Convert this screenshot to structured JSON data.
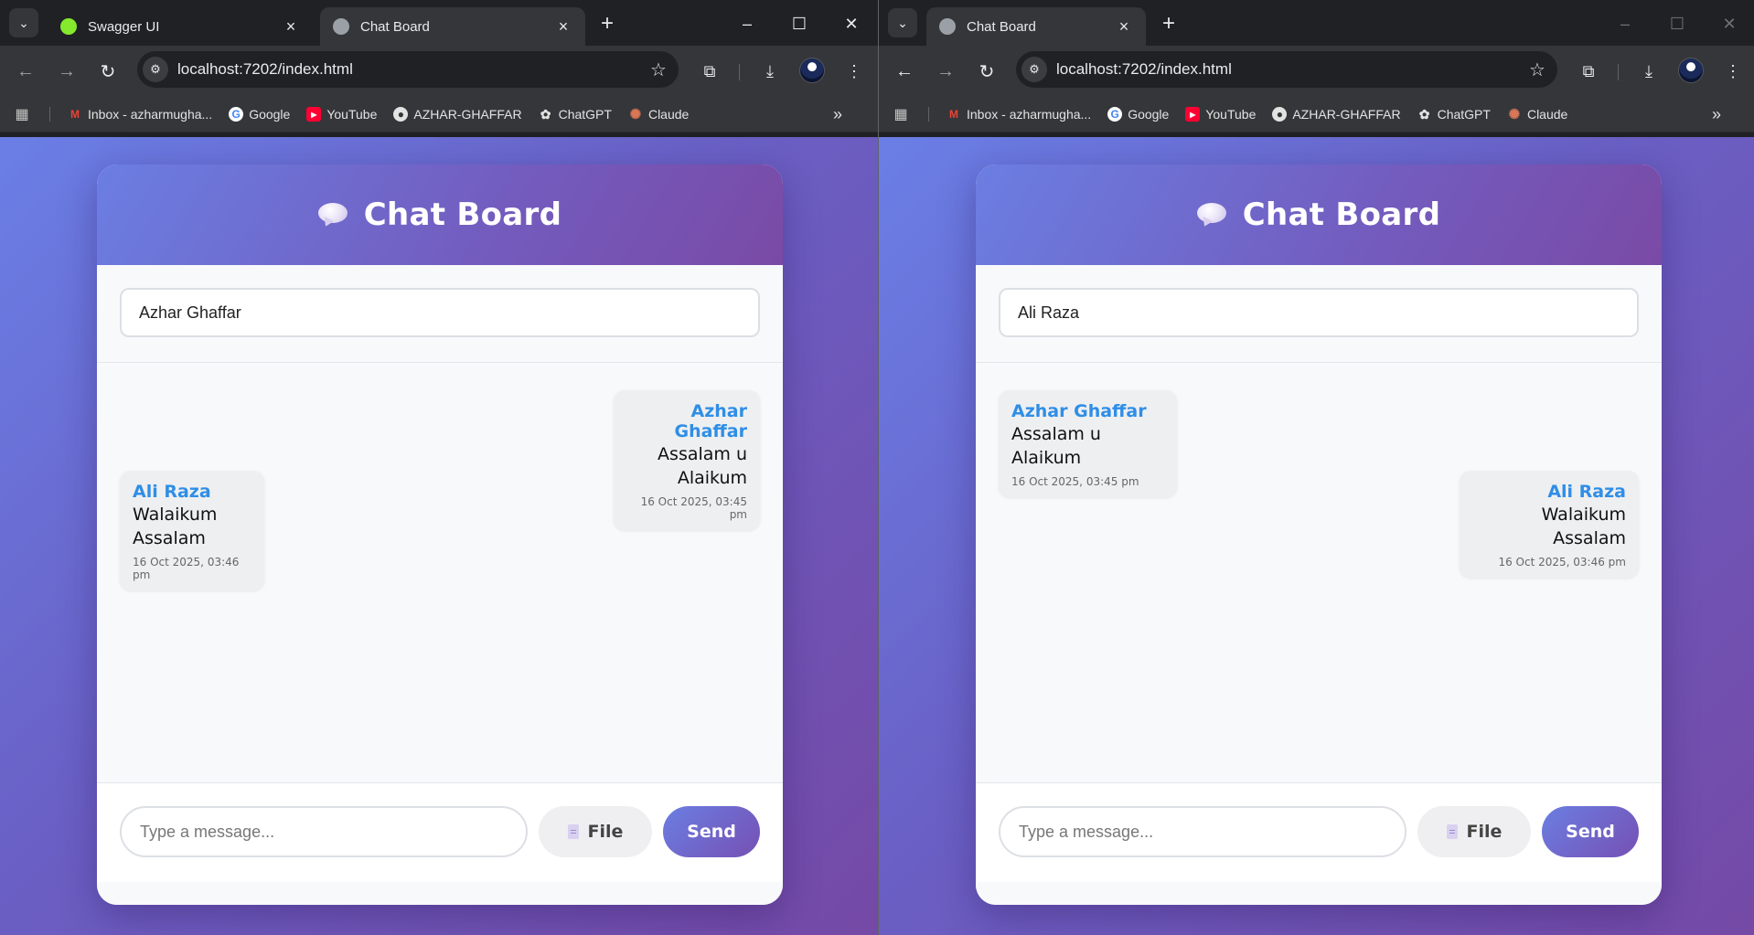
{
  "left": {
    "tabs": [
      {
        "title": "Swagger UI",
        "favicon_color": "#85ea2d",
        "active": false
      },
      {
        "title": "Chat Board",
        "favicon_color": "#9aa0a6",
        "active": true
      }
    ],
    "url": "localhost:7202/index.html",
    "bookmarks": [
      {
        "label": "Inbox - azharmugha...",
        "icon": "gmail-icon"
      },
      {
        "label": "Google",
        "icon": "google-icon"
      },
      {
        "label": "YouTube",
        "icon": "youtube-icon"
      },
      {
        "label": "AZHAR-GHAFFAR",
        "icon": "github-icon"
      },
      {
        "label": "ChatGPT",
        "icon": "chatgpt-icon"
      },
      {
        "label": "Claude",
        "icon": "claude-icon"
      }
    ],
    "app": {
      "title": "Chat Board",
      "name_value": "Azhar Ghaffar",
      "messages": [
        {
          "sender": "Azhar Ghaffar",
          "text": "Assalam u Alaikum",
          "time": "16 Oct 2025, 03:45 pm",
          "align": "right"
        },
        {
          "sender": "Ali Raza",
          "text": "Walaikum Assalam",
          "time": "16 Oct 2025, 03:46 pm",
          "align": "left"
        }
      ],
      "message_placeholder": "Type a message...",
      "file_label": "File",
      "send_label": "Send"
    }
  },
  "right": {
    "tabs": [
      {
        "title": "Chat Board",
        "favicon_color": "#9aa0a6",
        "active": true
      }
    ],
    "url": "localhost:7202/index.html",
    "bookmarks": [
      {
        "label": "Inbox - azharmugha...",
        "icon": "gmail-icon"
      },
      {
        "label": "Google",
        "icon": "google-icon"
      },
      {
        "label": "YouTube",
        "icon": "youtube-icon"
      },
      {
        "label": "AZHAR-GHAFFAR",
        "icon": "github-icon"
      },
      {
        "label": "ChatGPT",
        "icon": "chatgpt-icon"
      },
      {
        "label": "Claude",
        "icon": "claude-icon"
      }
    ],
    "app": {
      "title": "Chat Board",
      "name_value": "Ali Raza",
      "messages": [
        {
          "sender": "Azhar Ghaffar",
          "text": "Assalam u Alaikum",
          "time": "16 Oct 2025, 03:45 pm",
          "align": "left"
        },
        {
          "sender": "Ali Raza",
          "text": "Walaikum Assalam",
          "time": "16 Oct 2025, 03:46 pm",
          "align": "right"
        }
      ],
      "message_placeholder": "Type a message...",
      "file_label": "File",
      "send_label": "Send"
    }
  },
  "colors": {
    "accent_blue": "#2f8ee6",
    "header_gradient_start": "#6b7ee2",
    "header_gradient_end": "#7a4aa6"
  }
}
